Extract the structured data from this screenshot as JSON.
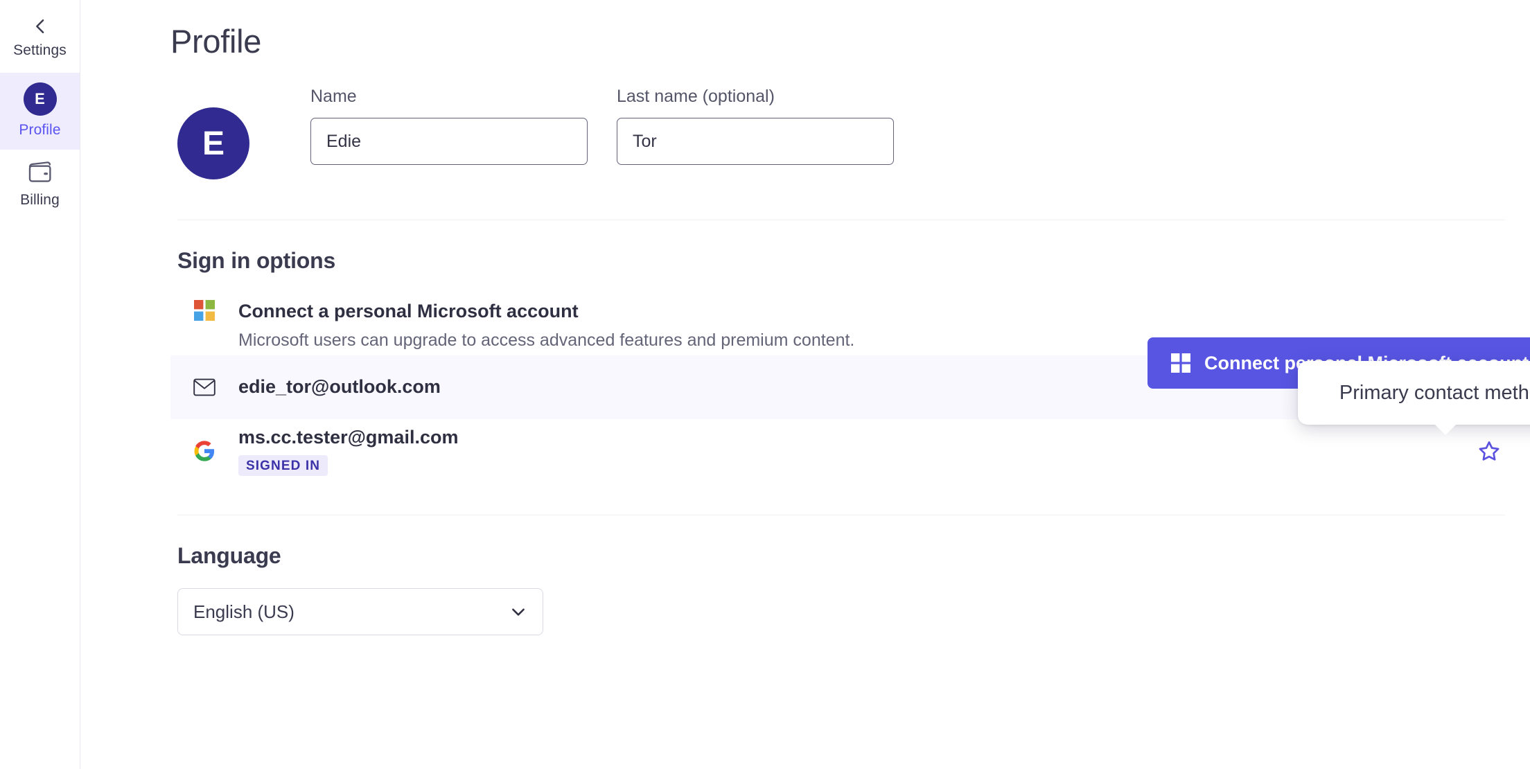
{
  "sidebar": {
    "items": [
      {
        "id": "back-settings",
        "label": "Settings",
        "icon": "chevron-left-icon",
        "active": false
      },
      {
        "id": "profile",
        "label": "Profile",
        "icon": "avatar-initial",
        "avatar_initial": "E",
        "active": true
      },
      {
        "id": "billing",
        "label": "Billing",
        "icon": "wallet-icon",
        "active": false
      }
    ]
  },
  "page": {
    "title": "Profile"
  },
  "identity": {
    "avatar_initial": "E",
    "fields": [
      {
        "id": "first-name",
        "label": "Name",
        "value": "Edie",
        "placeholder": "Name"
      },
      {
        "id": "last-name",
        "label": "Last name (optional)",
        "value": "Tor",
        "placeholder": "Last name"
      }
    ]
  },
  "signin": {
    "section_title": "Sign in options",
    "connect": {
      "icon": "microsoft-logo-icon",
      "title": "Connect a personal Microsoft account",
      "subtitle": "Microsoft users can upgrade to access advanced features and premium content.",
      "button_label": "Connect personal Microsoft account",
      "button_icon": "windows-logo-icon",
      "button_color": "#5855e3"
    },
    "accounts": [
      {
        "id": "outlook",
        "icon": "mail-icon",
        "email": "edie_tor@outlook.com",
        "badge": null,
        "primary": true,
        "star_icon": "star-filled-icon",
        "highlighted": true
      },
      {
        "id": "gmail",
        "icon": "google-logo-icon",
        "email": "ms.cc.tester@gmail.com",
        "badge": "SIGNED IN",
        "primary": false,
        "star_icon": "star-outline-icon",
        "highlighted": false
      }
    ]
  },
  "tooltip": {
    "text": "Primary contact method"
  },
  "language": {
    "section_title": "Language",
    "selected": "English (US)",
    "chevron": "chevron-down-icon"
  },
  "colors": {
    "accent": "#5855e3",
    "avatar": "#312a90",
    "active_nav_bg": "#eeecfd",
    "active_nav_text": "#5b54f0",
    "row_highlight": "#f9f8fe",
    "badge_bg": "#eceafb",
    "badge_text": "#3b32a8"
  }
}
